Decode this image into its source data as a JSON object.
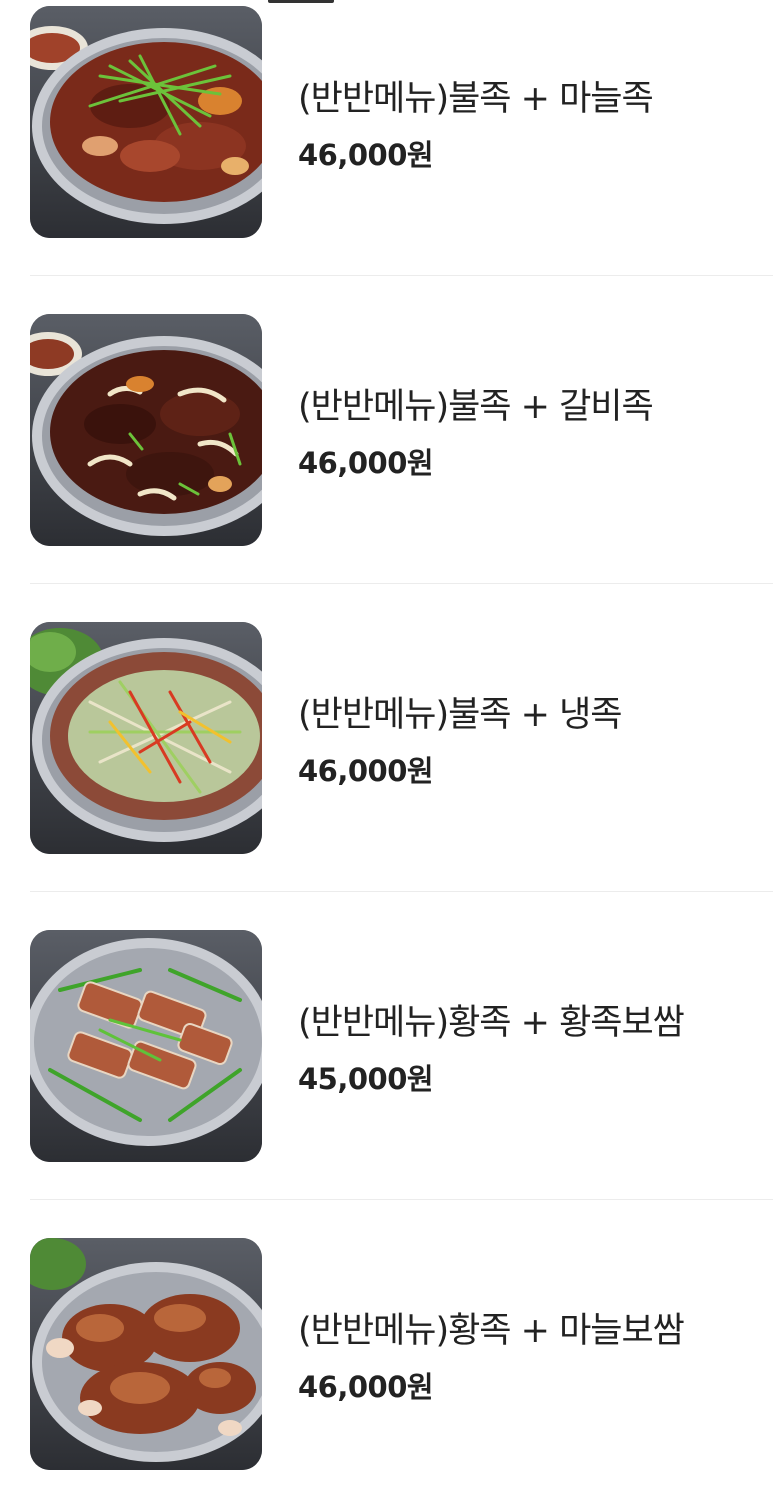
{
  "menu": {
    "items": [
      {
        "name": "(반반메뉴)불족 + 마늘족",
        "price": "46,000원",
        "photo": "spicy-jokbal-garlic-platter"
      },
      {
        "name": "(반반메뉴)불족 + 갈비족",
        "price": "46,000원",
        "photo": "spicy-jokbal-galbi-platter"
      },
      {
        "name": "(반반메뉴)불족 + 냉족",
        "price": "46,000원",
        "photo": "cold-jokbal-salad-platter"
      },
      {
        "name": "(반반메뉴)황족 + 황족보쌈",
        "price": "45,000원",
        "photo": "roasted-pork-bossam-platter"
      },
      {
        "name": "(반반메뉴)황족 + 마늘보쌈",
        "price": "46,000원",
        "photo": "roasted-pork-garlic-platter"
      }
    ]
  },
  "colors": {
    "text": "#222222",
    "divider": "#ececec",
    "photo_background": "#3a3d44"
  }
}
